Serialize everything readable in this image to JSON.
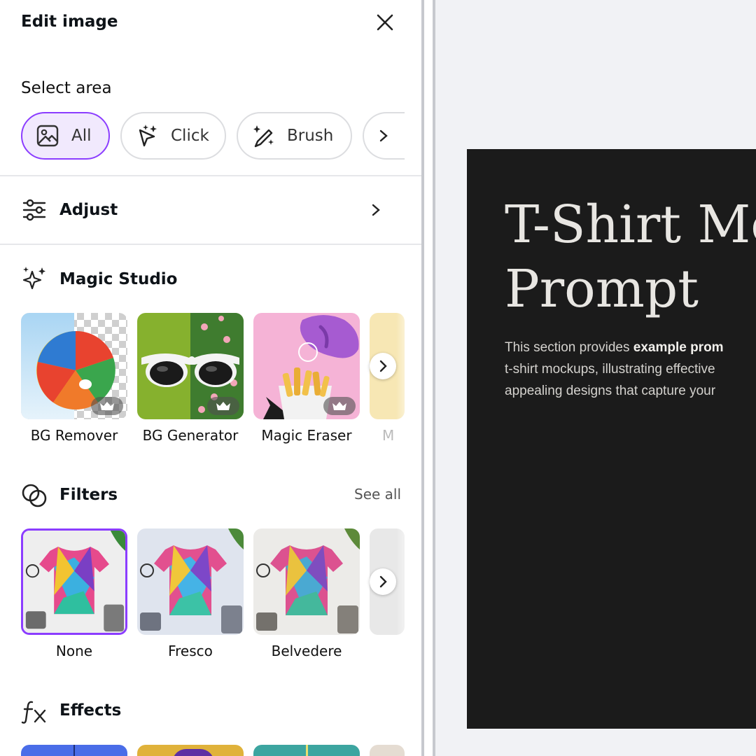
{
  "panel": {
    "title": "Edit image",
    "select_area": {
      "label": "Select area",
      "modes": [
        {
          "label": "All",
          "icon": "image-icon",
          "active": true
        },
        {
          "label": "Click",
          "icon": "magic-cursor-icon",
          "active": false
        },
        {
          "label": "Brush",
          "icon": "magic-brush-icon",
          "active": false
        }
      ]
    },
    "adjust": {
      "label": "Adjust",
      "icon": "sliders-icon"
    },
    "magic_studio": {
      "label": "Magic Studio",
      "icon": "sparkles-icon",
      "tools": [
        {
          "label": "BG Remover",
          "premium": true
        },
        {
          "label": "BG Generator",
          "premium": true
        },
        {
          "label": "Magic Eraser",
          "premium": true
        },
        {
          "label": "M",
          "premium": false
        }
      ]
    },
    "filters": {
      "label": "Filters",
      "see_all": "See all",
      "icon": "filters-icon",
      "items": [
        {
          "label": "None",
          "selected": true
        },
        {
          "label": "Fresco",
          "selected": false
        },
        {
          "label": "Belvedere",
          "selected": false
        }
      ]
    },
    "effects": {
      "label": "Effects",
      "icon": "fx-icon"
    }
  },
  "canvas": {
    "title": "T-Shirt Mo\nPrompt",
    "body_plain_1": "This section provides ",
    "body_bold": "example prom",
    "body_plain_2": "t-shirt mockups, illustrating effective",
    "body_plain_3": "appealing designs that capture your"
  },
  "colors": {
    "accent": "#8b3dff",
    "active_chip_bg": "#f1e9fd",
    "slide_bg": "#1b1b1b",
    "canvas_bg": "#f1f2f5"
  }
}
